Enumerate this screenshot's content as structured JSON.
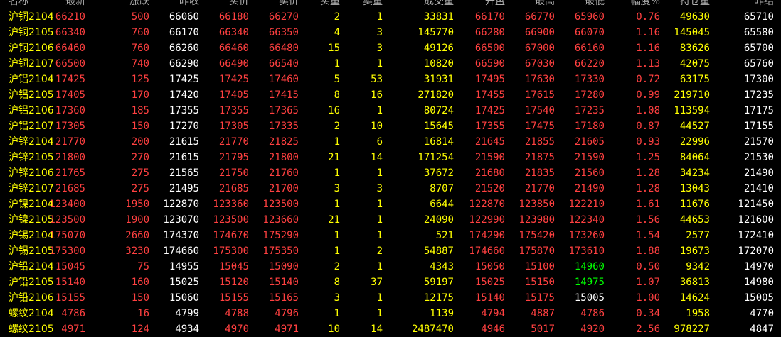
{
  "headers": {
    "name": "名称",
    "last": "最新",
    "chg": "涨跌",
    "prev": "昨收",
    "bid": "买价",
    "ask": "卖价",
    "bq": "买量",
    "aq": "卖量",
    "vol": "成交量",
    "open": "开盘",
    "high": "最高",
    "low": "最低",
    "pct": "幅度%",
    "oi": "持仓量",
    "set": "昨结"
  },
  "colors": {
    "up": "#ff4040",
    "neutral": "#ffffff",
    "qty": "#ffff00",
    "down": "#00ff00",
    "name": "#ffff00"
  },
  "rows": [
    {
      "name": "沪铜2104",
      "last": "66210",
      "chg": "500",
      "prev": "66060",
      "bid": "66180",
      "ask": "66270",
      "bq": "2",
      "aq": "1",
      "vol": "33831",
      "open": "66170",
      "high": "66770",
      "low": "65960",
      "pct": "0.76",
      "oi": "49630",
      "set": "65710"
    },
    {
      "name": "沪铜2105",
      "last": "66340",
      "chg": "760",
      "prev": "66170",
      "bid": "66340",
      "ask": "66350",
      "bq": "4",
      "aq": "3",
      "vol": "145770",
      "open": "66280",
      "high": "66900",
      "low": "66070",
      "pct": "1.16",
      "oi": "145045",
      "set": "65580"
    },
    {
      "name": "沪铜2106",
      "last": "66460",
      "chg": "760",
      "prev": "66260",
      "bid": "66460",
      "ask": "66480",
      "bq": "15",
      "aq": "3",
      "vol": "49126",
      "open": "66500",
      "high": "67000",
      "low": "66160",
      "pct": "1.16",
      "oi": "83626",
      "set": "65700"
    },
    {
      "name": "沪铜2107",
      "last": "66500",
      "chg": "740",
      "prev": "66290",
      "bid": "66490",
      "ask": "66540",
      "bq": "1",
      "aq": "1",
      "vol": "10820",
      "open": "66590",
      "high": "67030",
      "low": "66220",
      "pct": "1.13",
      "oi": "42075",
      "set": "65760"
    },
    {
      "name": "沪铝2104",
      "last": "17425",
      "chg": "125",
      "prev": "17425",
      "bid": "17425",
      "ask": "17460",
      "bq": "5",
      "aq": "53",
      "vol": "31931",
      "open": "17495",
      "high": "17630",
      "low": "17330",
      "pct": "0.72",
      "oi": "63175",
      "set": "17300"
    },
    {
      "name": "沪铝2105",
      "last": "17405",
      "chg": "170",
      "prev": "17420",
      "bid": "17405",
      "ask": "17415",
      "bq": "8",
      "aq": "16",
      "vol": "271820",
      "open": "17455",
      "high": "17615",
      "low": "17280",
      "pct": "0.99",
      "oi": "219710",
      "set": "17235"
    },
    {
      "name": "沪铝2106",
      "last": "17360",
      "chg": "185",
      "prev": "17355",
      "bid": "17355",
      "ask": "17365",
      "bq": "16",
      "aq": "1",
      "vol": "80724",
      "open": "17425",
      "high": "17540",
      "low": "17235",
      "pct": "1.08",
      "oi": "113594",
      "set": "17175"
    },
    {
      "name": "沪铝2107",
      "last": "17305",
      "chg": "150",
      "prev": "17270",
      "bid": "17305",
      "ask": "17335",
      "bq": "2",
      "aq": "10",
      "vol": "15645",
      "open": "17355",
      "high": "17475",
      "low": "17180",
      "pct": "0.87",
      "oi": "44527",
      "set": "17155"
    },
    {
      "name": "沪锌2104",
      "last": "21770",
      "chg": "200",
      "prev": "21615",
      "bid": "21770",
      "ask": "21825",
      "bq": "1",
      "aq": "6",
      "vol": "16814",
      "open": "21645",
      "high": "21855",
      "low": "21605",
      "pct": "0.93",
      "oi": "22996",
      "set": "21570"
    },
    {
      "name": "沪锌2105",
      "last": "21800",
      "chg": "270",
      "prev": "21615",
      "bid": "21795",
      "ask": "21800",
      "bq": "21",
      "aq": "14",
      "vol": "171254",
      "open": "21590",
      "high": "21875",
      "low": "21590",
      "pct": "1.25",
      "oi": "84064",
      "set": "21530"
    },
    {
      "name": "沪锌2106",
      "last": "21765",
      "chg": "275",
      "prev": "21565",
      "bid": "21750",
      "ask": "21760",
      "bq": "1",
      "aq": "1",
      "vol": "37672",
      "open": "21680",
      "high": "21835",
      "low": "21560",
      "pct": "1.28",
      "oi": "34234",
      "set": "21490"
    },
    {
      "name": "沪锌2107",
      "last": "21685",
      "chg": "275",
      "prev": "21495",
      "bid": "21685",
      "ask": "21700",
      "bq": "3",
      "aq": "3",
      "vol": "8707",
      "open": "21520",
      "high": "21770",
      "low": "21490",
      "pct": "1.28",
      "oi": "13043",
      "set": "21410"
    },
    {
      "name": "沪镍2104",
      "last": "123400",
      "chg": "1950",
      "prev": "122870",
      "bid": "123360",
      "ask": "123500",
      "bq": "1",
      "aq": "1",
      "vol": "6644",
      "open": "122870",
      "high": "123850",
      "low": "122210",
      "pct": "1.61",
      "oi": "11676",
      "set": "121450"
    },
    {
      "name": "沪镍2105",
      "last": "123500",
      "chg": "1900",
      "prev": "123070",
      "bid": "123500",
      "ask": "123660",
      "bq": "21",
      "aq": "1",
      "vol": "24090",
      "open": "122990",
      "high": "123980",
      "low": "122340",
      "pct": "1.56",
      "oi": "44653",
      "set": "121600"
    },
    {
      "name": "沪锡2104",
      "last": "175070",
      "chg": "2660",
      "prev": "174370",
      "bid": "174670",
      "ask": "175290",
      "bq": "1",
      "aq": "1",
      "vol": "521",
      "open": "174290",
      "high": "175420",
      "low": "173260",
      "pct": "1.54",
      "oi": "2577",
      "set": "172410"
    },
    {
      "name": "沪锡2105",
      "last": "175300",
      "chg": "3230",
      "prev": "174660",
      "bid": "175300",
      "ask": "175350",
      "bq": "1",
      "aq": "2",
      "vol": "54887",
      "open": "174660",
      "high": "175870",
      "low": "173610",
      "pct": "1.88",
      "oi": "19673",
      "set": "172070"
    },
    {
      "name": "沪铅2104",
      "last": "15045",
      "chg": "75",
      "prev": "14955",
      "bid": "15045",
      "ask": "15090",
      "bq": "2",
      "aq": "1",
      "vol": "4343",
      "open": "15050",
      "high": "15100",
      "low": "14960",
      "pct": "0.50",
      "oi": "9342",
      "set": "14970"
    },
    {
      "name": "沪铅2105",
      "last": "15140",
      "chg": "160",
      "prev": "15025",
      "bid": "15120",
      "ask": "15140",
      "bq": "8",
      "aq": "37",
      "vol": "59197",
      "open": "15025",
      "high": "15150",
      "low": "14975",
      "pct": "1.07",
      "oi": "36813",
      "set": "14980"
    },
    {
      "name": "沪铅2106",
      "last": "15155",
      "chg": "150",
      "prev": "15060",
      "bid": "15155",
      "ask": "15165",
      "bq": "3",
      "aq": "1",
      "vol": "12175",
      "open": "15140",
      "high": "15175",
      "low": "15005",
      "pct": "1.00",
      "oi": "14624",
      "set": "15005"
    },
    {
      "name": "螺纹2104",
      "last": "4786",
      "chg": "16",
      "prev": "4799",
      "bid": "4788",
      "ask": "4796",
      "bq": "1",
      "aq": "1",
      "vol": "1139",
      "open": "4794",
      "high": "4887",
      "low": "4786",
      "pct": "0.34",
      "oi": "1958",
      "set": "4770"
    },
    {
      "name": "螺纹2105",
      "last": "4971",
      "chg": "124",
      "prev": "4934",
      "bid": "4970",
      "ask": "4971",
      "bq": "10",
      "aq": "14",
      "vol": "2487470",
      "open": "4946",
      "high": "5017",
      "low": "4920",
      "pct": "2.56",
      "oi": "978227",
      "set": "4847"
    }
  ]
}
